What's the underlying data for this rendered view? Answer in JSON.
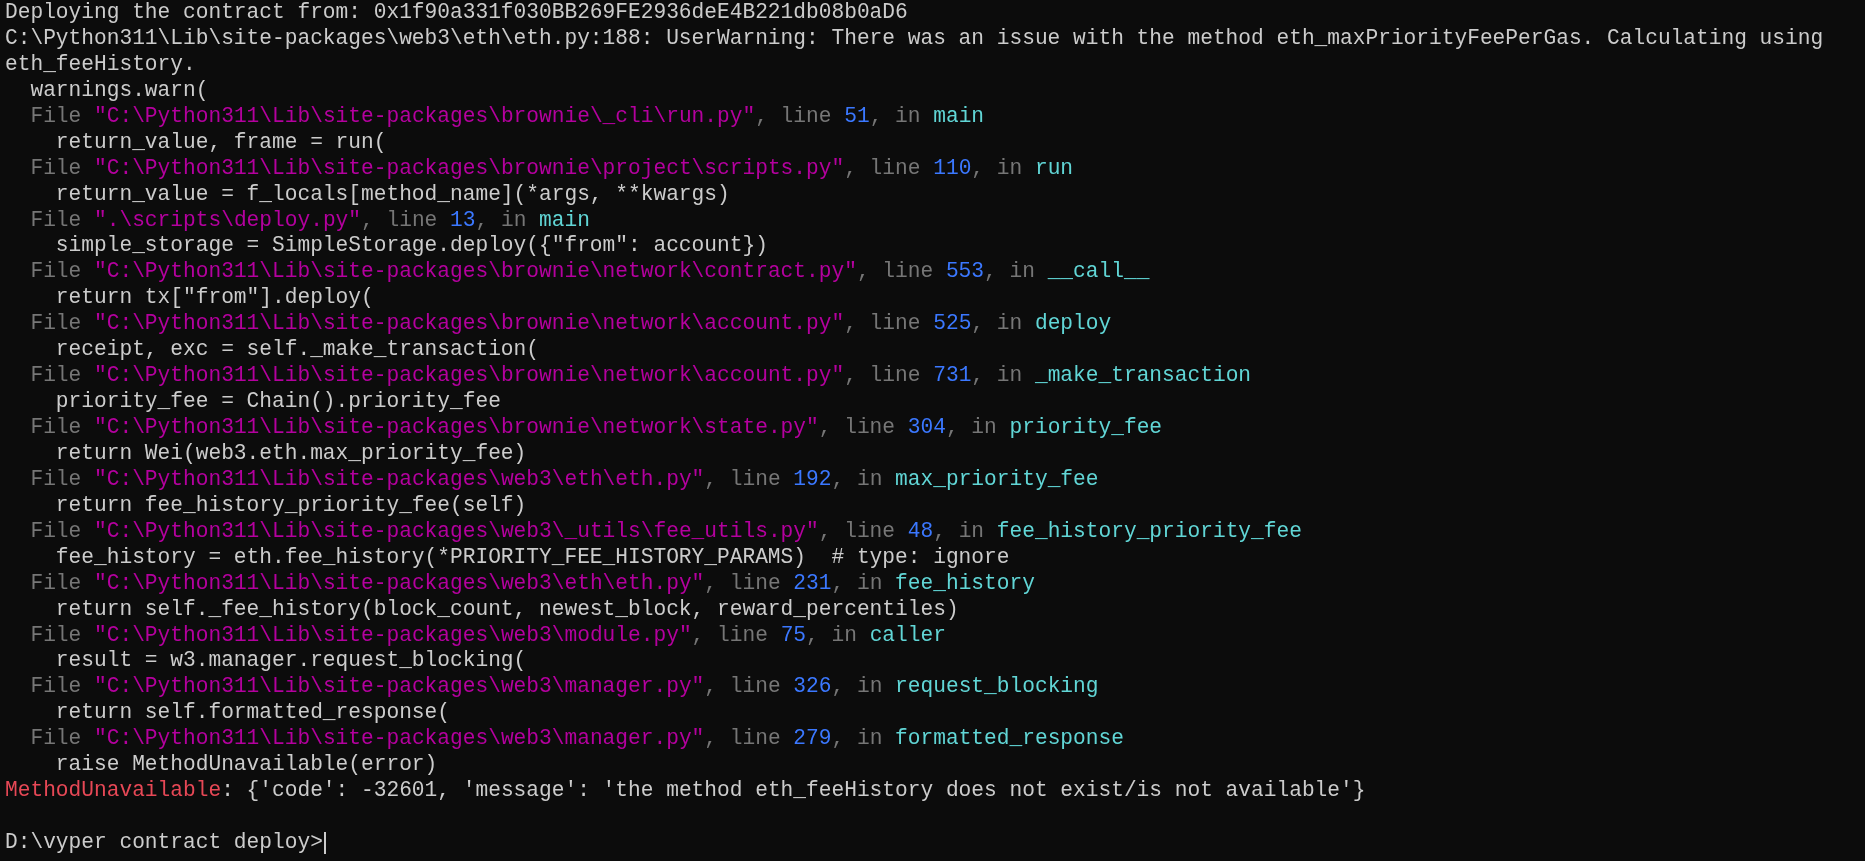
{
  "terminal": {
    "lines": [
      {
        "kind": "text",
        "segments": [
          {
            "kind": "plain",
            "text": "Deploying the contract from: 0x1f90a331f030BB269FE2936deE4B221db08b0aD6"
          }
        ]
      },
      {
        "kind": "text",
        "segments": [
          {
            "kind": "plain",
            "text": "C:\\Python311\\Lib\\site-packages\\web3\\eth\\eth.py:188: UserWarning: There was an issue with the method eth_maxPriorityFeePerGas. Calculating using"
          }
        ]
      },
      {
        "kind": "text",
        "segments": [
          {
            "kind": "plain",
            "text": "eth_feeHistory."
          }
        ]
      },
      {
        "kind": "text",
        "segments": [
          {
            "kind": "plain",
            "text": "  warnings.warn("
          }
        ]
      },
      {
        "kind": "text",
        "segments": [
          {
            "kind": "dim",
            "text": "  File "
          },
          {
            "kind": "path",
            "text": "\"C:\\Python311\\Lib\\site-packages\\brownie\\_cli\\run.py\""
          },
          {
            "kind": "dim",
            "text": ", line "
          },
          {
            "kind": "number",
            "text": "51"
          },
          {
            "kind": "dim",
            "text": ", in "
          },
          {
            "kind": "func",
            "text": "main"
          }
        ]
      },
      {
        "kind": "text",
        "segments": [
          {
            "kind": "plain",
            "text": "    return_value, frame = run("
          }
        ]
      },
      {
        "kind": "text",
        "segments": [
          {
            "kind": "dim",
            "text": "  File "
          },
          {
            "kind": "path",
            "text": "\"C:\\Python311\\Lib\\site-packages\\brownie\\project\\scripts.py\""
          },
          {
            "kind": "dim",
            "text": ", line "
          },
          {
            "kind": "number",
            "text": "110"
          },
          {
            "kind": "dim",
            "text": ", in "
          },
          {
            "kind": "func",
            "text": "run"
          }
        ]
      },
      {
        "kind": "text",
        "segments": [
          {
            "kind": "plain",
            "text": "    return_value = f_locals[method_name](*args, **kwargs)"
          }
        ]
      },
      {
        "kind": "text",
        "segments": [
          {
            "kind": "dim",
            "text": "  File "
          },
          {
            "kind": "path",
            "text": "\".\\scripts\\deploy.py\""
          },
          {
            "kind": "dim",
            "text": ", line "
          },
          {
            "kind": "number",
            "text": "13"
          },
          {
            "kind": "dim",
            "text": ", in "
          },
          {
            "kind": "func",
            "text": "main"
          }
        ]
      },
      {
        "kind": "text",
        "segments": [
          {
            "kind": "plain",
            "text": "    simple_storage = SimpleStorage.deploy({\"from\": account})"
          }
        ]
      },
      {
        "kind": "text",
        "segments": [
          {
            "kind": "dim",
            "text": "  File "
          },
          {
            "kind": "path",
            "text": "\"C:\\Python311\\Lib\\site-packages\\brownie\\network\\contract.py\""
          },
          {
            "kind": "dim",
            "text": ", line "
          },
          {
            "kind": "number",
            "text": "553"
          },
          {
            "kind": "dim",
            "text": ", in "
          },
          {
            "kind": "func",
            "text": "__call__"
          }
        ]
      },
      {
        "kind": "text",
        "segments": [
          {
            "kind": "plain",
            "text": "    return tx[\"from\"].deploy("
          }
        ]
      },
      {
        "kind": "text",
        "segments": [
          {
            "kind": "dim",
            "text": "  File "
          },
          {
            "kind": "path",
            "text": "\"C:\\Python311\\Lib\\site-packages\\brownie\\network\\account.py\""
          },
          {
            "kind": "dim",
            "text": ", line "
          },
          {
            "kind": "number",
            "text": "525"
          },
          {
            "kind": "dim",
            "text": ", in "
          },
          {
            "kind": "func",
            "text": "deploy"
          }
        ]
      },
      {
        "kind": "text",
        "segments": [
          {
            "kind": "plain",
            "text": "    receipt, exc = self._make_transaction("
          }
        ]
      },
      {
        "kind": "text",
        "segments": [
          {
            "kind": "dim",
            "text": "  File "
          },
          {
            "kind": "path",
            "text": "\"C:\\Python311\\Lib\\site-packages\\brownie\\network\\account.py\""
          },
          {
            "kind": "dim",
            "text": ", line "
          },
          {
            "kind": "number",
            "text": "731"
          },
          {
            "kind": "dim",
            "text": ", in "
          },
          {
            "kind": "func",
            "text": "_make_transaction"
          }
        ]
      },
      {
        "kind": "text",
        "segments": [
          {
            "kind": "plain",
            "text": "    priority_fee = Chain().priority_fee"
          }
        ]
      },
      {
        "kind": "text",
        "segments": [
          {
            "kind": "dim",
            "text": "  File "
          },
          {
            "kind": "path",
            "text": "\"C:\\Python311\\Lib\\site-packages\\brownie\\network\\state.py\""
          },
          {
            "kind": "dim",
            "text": ", line "
          },
          {
            "kind": "number",
            "text": "304"
          },
          {
            "kind": "dim",
            "text": ", in "
          },
          {
            "kind": "func",
            "text": "priority_fee"
          }
        ]
      },
      {
        "kind": "text",
        "segments": [
          {
            "kind": "plain",
            "text": "    return Wei(web3.eth.max_priority_fee)"
          }
        ]
      },
      {
        "kind": "text",
        "segments": [
          {
            "kind": "dim",
            "text": "  File "
          },
          {
            "kind": "path",
            "text": "\"C:\\Python311\\Lib\\site-packages\\web3\\eth\\eth.py\""
          },
          {
            "kind": "dim",
            "text": ", line "
          },
          {
            "kind": "number",
            "text": "192"
          },
          {
            "kind": "dim",
            "text": ", in "
          },
          {
            "kind": "func",
            "text": "max_priority_fee"
          }
        ]
      },
      {
        "kind": "text",
        "segments": [
          {
            "kind": "plain",
            "text": "    return fee_history_priority_fee(self)"
          }
        ]
      },
      {
        "kind": "text",
        "segments": [
          {
            "kind": "dim",
            "text": "  File "
          },
          {
            "kind": "path",
            "text": "\"C:\\Python311\\Lib\\site-packages\\web3\\_utils\\fee_utils.py\""
          },
          {
            "kind": "dim",
            "text": ", line "
          },
          {
            "kind": "number",
            "text": "48"
          },
          {
            "kind": "dim",
            "text": ", in "
          },
          {
            "kind": "func",
            "text": "fee_history_priority_fee"
          }
        ]
      },
      {
        "kind": "text",
        "segments": [
          {
            "kind": "plain",
            "text": "    fee_history = eth.fee_history(*PRIORITY_FEE_HISTORY_PARAMS)  # type: ignore"
          }
        ]
      },
      {
        "kind": "text",
        "segments": [
          {
            "kind": "dim",
            "text": "  File "
          },
          {
            "kind": "path",
            "text": "\"C:\\Python311\\Lib\\site-packages\\web3\\eth\\eth.py\""
          },
          {
            "kind": "dim",
            "text": ", line "
          },
          {
            "kind": "number",
            "text": "231"
          },
          {
            "kind": "dim",
            "text": ", in "
          },
          {
            "kind": "func",
            "text": "fee_history"
          }
        ]
      },
      {
        "kind": "text",
        "segments": [
          {
            "kind": "plain",
            "text": "    return self._fee_history(block_count, newest_block, reward_percentiles)"
          }
        ]
      },
      {
        "kind": "text",
        "segments": [
          {
            "kind": "dim",
            "text": "  File "
          },
          {
            "kind": "path",
            "text": "\"C:\\Python311\\Lib\\site-packages\\web3\\module.py\""
          },
          {
            "kind": "dim",
            "text": ", line "
          },
          {
            "kind": "number",
            "text": "75"
          },
          {
            "kind": "dim",
            "text": ", in "
          },
          {
            "kind": "func",
            "text": "caller"
          }
        ]
      },
      {
        "kind": "text",
        "segments": [
          {
            "kind": "plain",
            "text": "    result = w3.manager.request_blocking("
          }
        ]
      },
      {
        "kind": "text",
        "segments": [
          {
            "kind": "dim",
            "text": "  File "
          },
          {
            "kind": "path",
            "text": "\"C:\\Python311\\Lib\\site-packages\\web3\\manager.py\""
          },
          {
            "kind": "dim",
            "text": ", line "
          },
          {
            "kind": "number",
            "text": "326"
          },
          {
            "kind": "dim",
            "text": ", in "
          },
          {
            "kind": "func",
            "text": "request_blocking"
          }
        ]
      },
      {
        "kind": "text",
        "segments": [
          {
            "kind": "plain",
            "text": "    return self.formatted_response("
          }
        ]
      },
      {
        "kind": "text",
        "segments": [
          {
            "kind": "dim",
            "text": "  File "
          },
          {
            "kind": "path",
            "text": "\"C:\\Python311\\Lib\\site-packages\\web3\\manager.py\""
          },
          {
            "kind": "dim",
            "text": ", line "
          },
          {
            "kind": "number",
            "text": "279"
          },
          {
            "kind": "dim",
            "text": ", in "
          },
          {
            "kind": "func",
            "text": "formatted_response"
          }
        ]
      },
      {
        "kind": "text",
        "segments": [
          {
            "kind": "plain",
            "text": "    raise MethodUnavailable(error)"
          }
        ]
      },
      {
        "kind": "text",
        "segments": [
          {
            "kind": "error",
            "text": "MethodUnavailable"
          },
          {
            "kind": "plain",
            "text": ": {'code': -32601, 'message': 'the method eth_feeHistory does not exist/is not available'}"
          }
        ]
      },
      {
        "kind": "blank"
      },
      {
        "kind": "prompt",
        "segments": [
          {
            "kind": "plain",
            "text": "D:\\vyper contract deploy>"
          }
        ]
      }
    ]
  }
}
